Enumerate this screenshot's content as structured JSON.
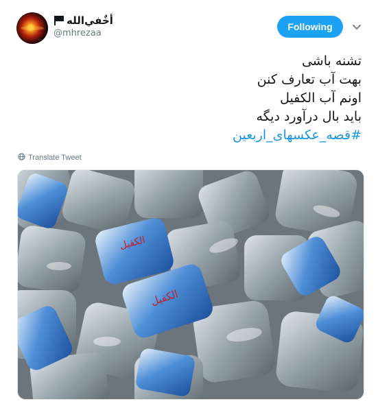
{
  "user": {
    "display_name": "أخٌفي‌الله",
    "handle": "@mhrezaa",
    "avatar_icon": "avatar-image",
    "flag_icon": "black-flag-icon"
  },
  "follow_button": {
    "label": "Following",
    "color": "#1da1f2"
  },
  "menu_icon": "chevron-down-icon",
  "tweet": {
    "lines": [
      "تشنه باشی",
      "بهت آب تعارف کنن",
      "اونم آب الکفیل",
      "باید بال درآورد دیگه"
    ],
    "hashtag": "#قصه_عکسهای_اربعین",
    "hashtag_color": "#1b95e0"
  },
  "translate": {
    "label": "Translate Tweet",
    "icon": "globe-icon"
  },
  "media": {
    "description_icon": "photo-water-cups",
    "cup_label_text": "الکفیل"
  }
}
